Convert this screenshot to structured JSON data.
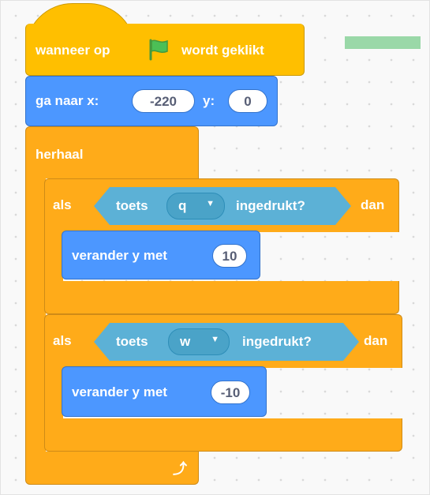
{
  "green_flag_block": {
    "prefix": "wanneer op",
    "icon": "green-flag-icon",
    "suffix": "wordt geklikt"
  },
  "goto_block": {
    "label_x": "ga naar x:",
    "x_value": "-220",
    "label_y": "y:",
    "y_value": "0"
  },
  "repeat_block": {
    "label": "herhaal",
    "loop_icon": "loop-arrow-icon"
  },
  "if_blocks": [
    {
      "keyword": "als",
      "condition": {
        "prefix": "toets",
        "key": "q",
        "suffix": "ingedrukt?"
      },
      "then": "dan",
      "inner": {
        "label": "verander y met",
        "value": "10"
      }
    },
    {
      "keyword": "als",
      "condition": {
        "prefix": "toets",
        "key": "w",
        "suffix": "ingedrukt?"
      },
      "then": "dan",
      "inner": {
        "label": "verander y met",
        "value": "-10"
      }
    }
  ],
  "colors": {
    "events": "#ffbf00",
    "motion": "#4c97ff",
    "control": "#ffab19",
    "sensing": "#5cb1d6",
    "flag": "#4cbf56"
  }
}
